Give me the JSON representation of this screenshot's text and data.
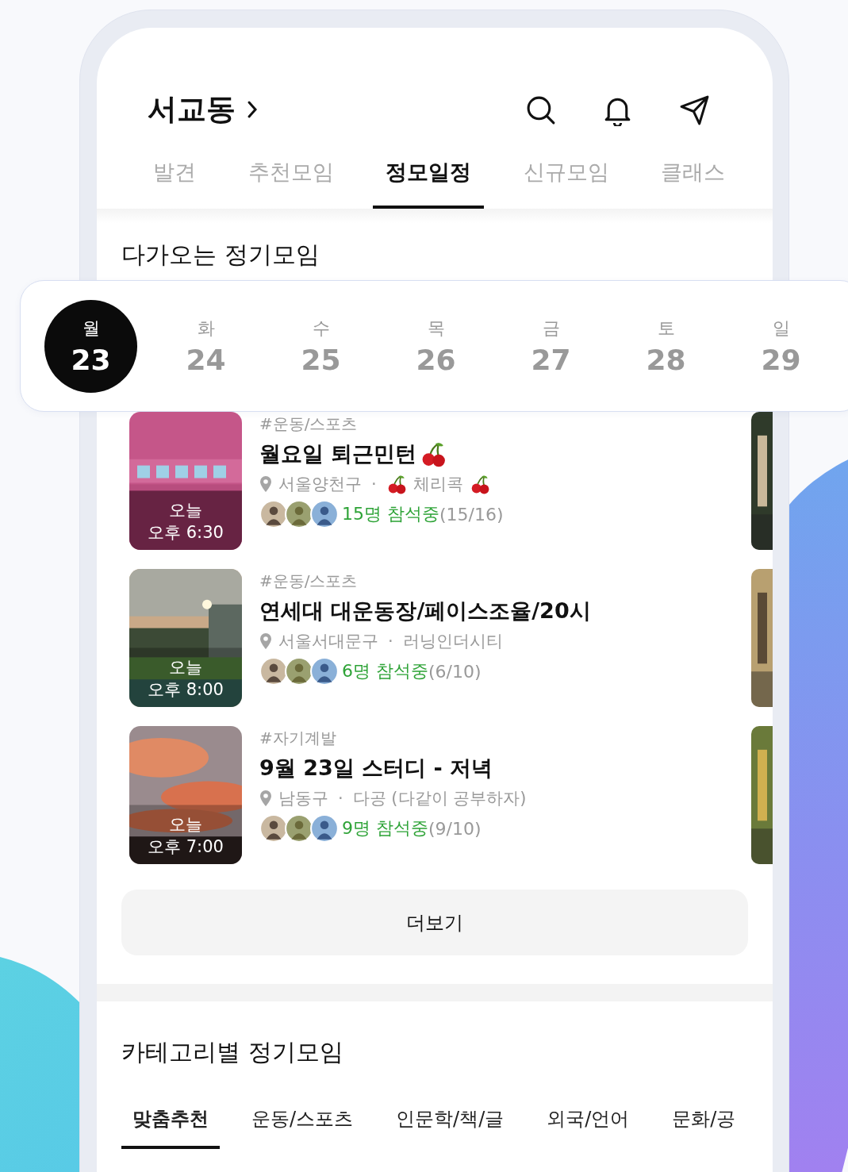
{
  "header": {
    "location": "서교동"
  },
  "tabs": [
    {
      "label": "발견",
      "selected": false
    },
    {
      "label": "추천모임",
      "selected": false
    },
    {
      "label": "정모일정",
      "selected": true
    },
    {
      "label": "신규모임",
      "selected": false
    },
    {
      "label": "클래스",
      "selected": false
    }
  ],
  "upcoming": {
    "title": "다가오는 정기모임",
    "days": [
      {
        "weekday": "월",
        "date": "23",
        "selected": true
      },
      {
        "weekday": "화",
        "date": "24",
        "selected": false
      },
      {
        "weekday": "수",
        "date": "25",
        "selected": false
      },
      {
        "weekday": "목",
        "date": "26",
        "selected": false
      },
      {
        "weekday": "금",
        "date": "27",
        "selected": false
      },
      {
        "weekday": "토",
        "date": "28",
        "selected": false
      },
      {
        "weekday": "일",
        "date": "29",
        "selected": false
      }
    ],
    "meetups": [
      {
        "day": "오늘",
        "time": "오후 6:30",
        "category": "#운동/스포츠",
        "title": "월요일 퇴근민턴",
        "region": "서울양천구",
        "club": "체리콕",
        "cherries": true,
        "separator": "·",
        "attending": "15명 참석중",
        "capacity": "(15/16)"
      },
      {
        "day": "오늘",
        "time": "오후 8:00",
        "category": "#운동/스포츠",
        "title": "연세대 대운동장/페이스조율/20시",
        "region": "서울서대문구",
        "club": "러닝인더시티",
        "cherries": false,
        "separator": "·",
        "attending": "6명 참석중",
        "capacity": "(6/10)"
      },
      {
        "day": "오늘",
        "time": "오후 7:00",
        "category": "#자기계발",
        "title": "9월 23일 스터디 - 저녁",
        "region": "남동구",
        "club": "다공 (다같이 공부하자)",
        "cherries": false,
        "separator": "·",
        "attending": "9명 참석중",
        "capacity": "(9/10)"
      }
    ],
    "more": "더보기"
  },
  "categories": {
    "title": "카테고리별 정기모임",
    "tabs": [
      {
        "label": "맞춤추천",
        "selected": true
      },
      {
        "label": "운동/스포츠",
        "selected": false
      },
      {
        "label": "인문학/책/글",
        "selected": false
      },
      {
        "label": "외국/언어",
        "selected": false
      },
      {
        "label": "문화/공",
        "selected": false
      }
    ]
  }
}
